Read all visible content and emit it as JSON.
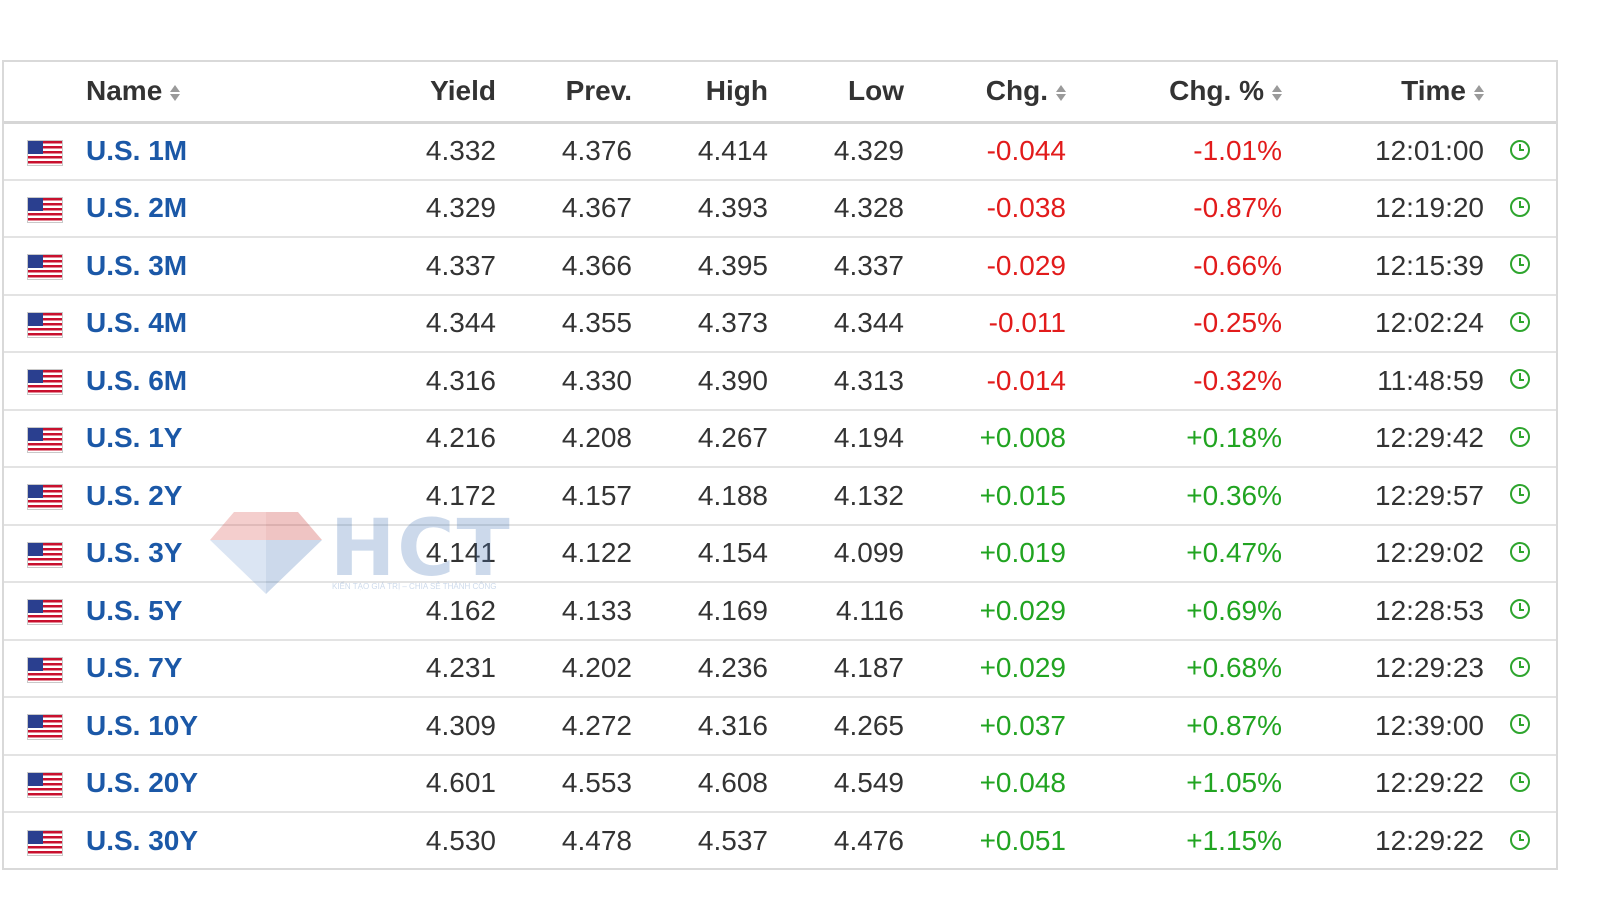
{
  "columns": {
    "name": "Name",
    "yield": "Yield",
    "prev": "Prev.",
    "high": "High",
    "low": "Low",
    "chg": "Chg.",
    "chg_pct": "Chg. %",
    "time": "Time"
  },
  "colors": {
    "link": "#1b58a7",
    "negative": "#e21b1b",
    "positive": "#21a421",
    "clock": "#2ea52e"
  },
  "icons": {
    "flag": "us-flag-icon",
    "clock": "clock-icon",
    "sort": "sort-icon"
  },
  "watermark": {
    "logo_text": "HCT",
    "tagline": "KIẾN TẠO GIÁ TRỊ – CHIA SẺ THÀNH CÔNG"
  },
  "rows": [
    {
      "name": "U.S. 1M",
      "yield": "4.332",
      "prev": "4.376",
      "high": "4.414",
      "low": "4.329",
      "chg": "-0.044",
      "chg_pct": "-1.01%",
      "time": "12:01:00",
      "direction": "neg"
    },
    {
      "name": "U.S. 2M",
      "yield": "4.329",
      "prev": "4.367",
      "high": "4.393",
      "low": "4.328",
      "chg": "-0.038",
      "chg_pct": "-0.87%",
      "time": "12:19:20",
      "direction": "neg"
    },
    {
      "name": "U.S. 3M",
      "yield": "4.337",
      "prev": "4.366",
      "high": "4.395",
      "low": "4.337",
      "chg": "-0.029",
      "chg_pct": "-0.66%",
      "time": "12:15:39",
      "direction": "neg"
    },
    {
      "name": "U.S. 4M",
      "yield": "4.344",
      "prev": "4.355",
      "high": "4.373",
      "low": "4.344",
      "chg": "-0.011",
      "chg_pct": "-0.25%",
      "time": "12:02:24",
      "direction": "neg"
    },
    {
      "name": "U.S. 6M",
      "yield": "4.316",
      "prev": "4.330",
      "high": "4.390",
      "low": "4.313",
      "chg": "-0.014",
      "chg_pct": "-0.32%",
      "time": "11:48:59",
      "direction": "neg"
    },
    {
      "name": "U.S. 1Y",
      "yield": "4.216",
      "prev": "4.208",
      "high": "4.267",
      "low": "4.194",
      "chg": "+0.008",
      "chg_pct": "+0.18%",
      "time": "12:29:42",
      "direction": "pos"
    },
    {
      "name": "U.S. 2Y",
      "yield": "4.172",
      "prev": "4.157",
      "high": "4.188",
      "low": "4.132",
      "chg": "+0.015",
      "chg_pct": "+0.36%",
      "time": "12:29:57",
      "direction": "pos"
    },
    {
      "name": "U.S. 3Y",
      "yield": "4.141",
      "prev": "4.122",
      "high": "4.154",
      "low": "4.099",
      "chg": "+0.019",
      "chg_pct": "+0.47%",
      "time": "12:29:02",
      "direction": "pos"
    },
    {
      "name": "U.S. 5Y",
      "yield": "4.162",
      "prev": "4.133",
      "high": "4.169",
      "low": "4.116",
      "chg": "+0.029",
      "chg_pct": "+0.69%",
      "time": "12:28:53",
      "direction": "pos"
    },
    {
      "name": "U.S. 7Y",
      "yield": "4.231",
      "prev": "4.202",
      "high": "4.236",
      "low": "4.187",
      "chg": "+0.029",
      "chg_pct": "+0.68%",
      "time": "12:29:23",
      "direction": "pos"
    },
    {
      "name": "U.S. 10Y",
      "yield": "4.309",
      "prev": "4.272",
      "high": "4.316",
      "low": "4.265",
      "chg": "+0.037",
      "chg_pct": "+0.87%",
      "time": "12:39:00",
      "direction": "pos"
    },
    {
      "name": "U.S. 20Y",
      "yield": "4.601",
      "prev": "4.553",
      "high": "4.608",
      "low": "4.549",
      "chg": "+0.048",
      "chg_pct": "+1.05%",
      "time": "12:29:22",
      "direction": "pos"
    },
    {
      "name": "U.S. 30Y",
      "yield": "4.530",
      "prev": "4.478",
      "high": "4.537",
      "low": "4.476",
      "chg": "+0.051",
      "chg_pct": "+1.15%",
      "time": "12:29:22",
      "direction": "pos"
    }
  ]
}
